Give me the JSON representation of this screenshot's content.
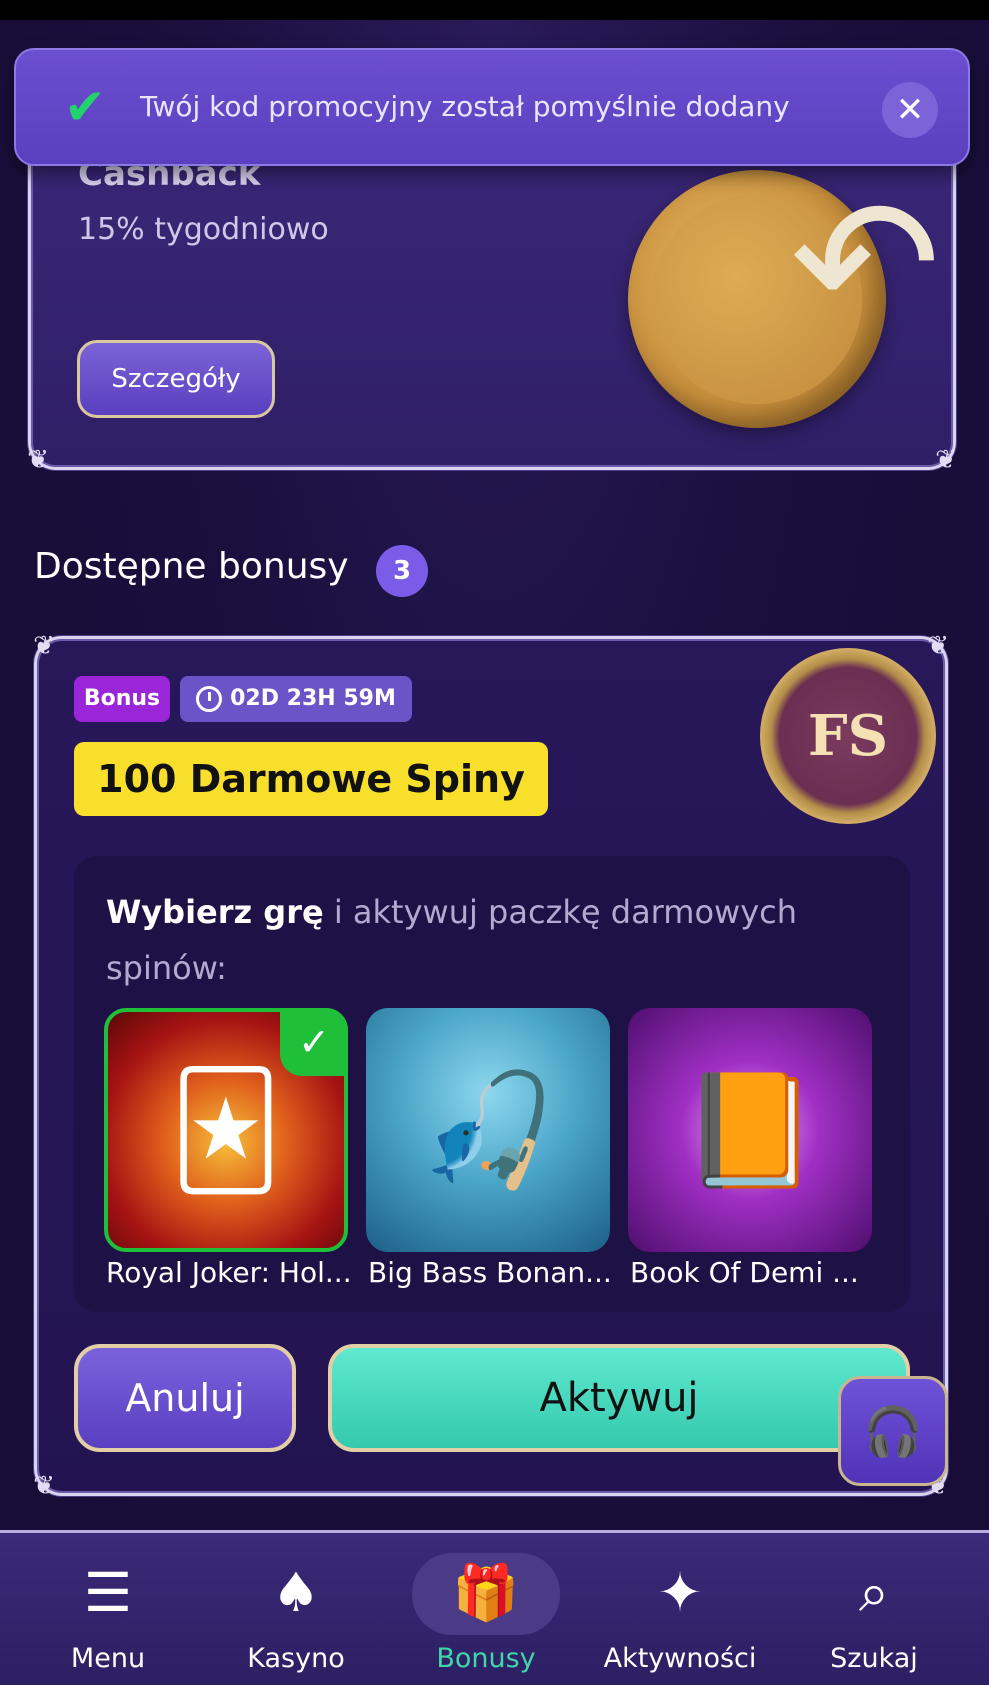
{
  "toast": {
    "message": "Twój kod promocyjny został pomyślnie dodany",
    "check_icon": "check-icon",
    "close_icon": "close-icon"
  },
  "cashback": {
    "title": "Cashback",
    "subtitle": "15% tygodniowo",
    "details_button": "Szczegóły"
  },
  "available": {
    "title": "Dostępne bonusy",
    "count": "3"
  },
  "bonus_card": {
    "tag": "Bonus",
    "timer": "02D 23H 59M",
    "headline": "100 Darmowe Spiny",
    "badge_text": "FS",
    "instruction_bold": "Wybierz grę",
    "instruction_rest": " i aktywuj paczkę darmowych spinów:",
    "games": [
      {
        "name": "Royal Joker: Hol...",
        "selected": true
      },
      {
        "name": "Big Bass Bonan...",
        "selected": false
      },
      {
        "name": "Book Of Demi ...",
        "selected": false
      }
    ],
    "cancel_button": "Anuluj",
    "activate_button": "Aktywuj"
  },
  "nav": {
    "items": [
      {
        "label": "Menu",
        "icon": "hamburger-icon"
      },
      {
        "label": "Kasyno",
        "icon": "spade-icon"
      },
      {
        "label": "Bonusy",
        "icon": "gift-icon",
        "active": true
      },
      {
        "label": "Aktywności",
        "icon": "sparkle-icon"
      },
      {
        "label": "Szukaj",
        "icon": "search-icon"
      }
    ]
  },
  "colors": {
    "accent_purple": "#6a54c7",
    "headline_yellow": "#f8df2c",
    "activate_teal": "#34c9ad",
    "active_nav_green": "#40d6a7",
    "success_green": "#22d36b"
  }
}
